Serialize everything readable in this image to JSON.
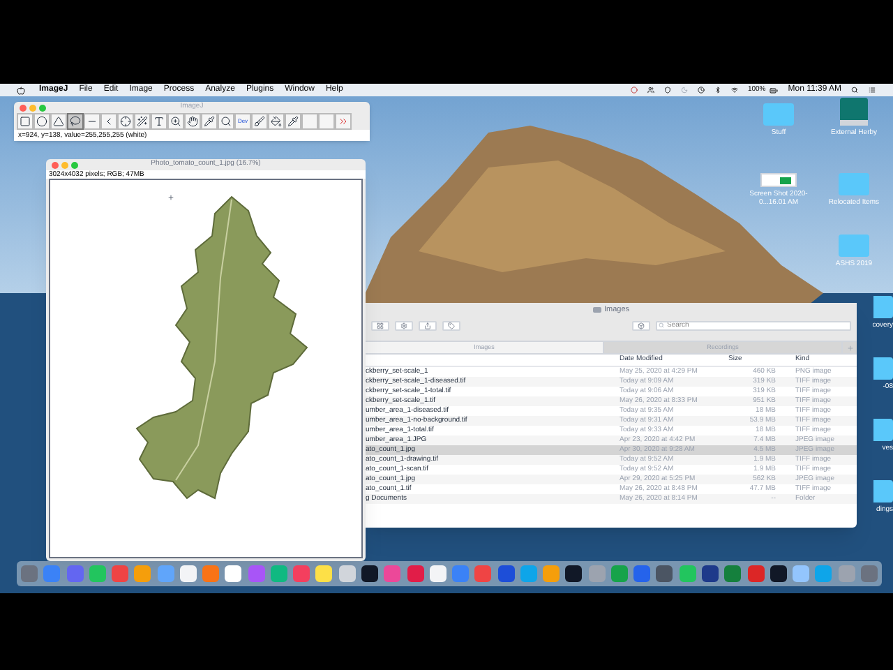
{
  "menu_bar": {
    "app": "ImageJ",
    "menus": [
      "File",
      "Edit",
      "Image",
      "Process",
      "Analyze",
      "Plugins",
      "Window",
      "Help"
    ],
    "battery": "100%",
    "clock": "Mon 11:39 AM"
  },
  "imagej_toolbar": {
    "title": "ImageJ",
    "tools": [
      {
        "kind": "rectangle",
        "selected": false
      },
      {
        "kind": "oval",
        "selected": false
      },
      {
        "kind": "polygon",
        "selected": false
      },
      {
        "kind": "freehand",
        "selected": true
      },
      {
        "kind": "line",
        "selected": false
      },
      {
        "kind": "angle",
        "selected": false
      },
      {
        "kind": "point",
        "selected": false
      },
      {
        "kind": "wand",
        "selected": false
      },
      {
        "kind": "text",
        "selected": false
      },
      {
        "kind": "zoom",
        "selected": false
      },
      {
        "kind": "hand",
        "selected": false
      },
      {
        "kind": "dropper",
        "selected": false
      },
      {
        "kind": "magnifier",
        "selected": false
      },
      {
        "kind": "dev",
        "label": "Dev",
        "selected": false
      },
      {
        "kind": "brush",
        "selected": false
      },
      {
        "kind": "flood",
        "selected": false
      },
      {
        "kind": "picker",
        "selected": false
      },
      {
        "kind": "blank",
        "selected": false
      },
      {
        "kind": "blank",
        "selected": false
      },
      {
        "kind": "more",
        "selected": false
      }
    ],
    "status": "x=924, y=138, value=255,255,255 (white)"
  },
  "image_window": {
    "title": "Photo_tomato_count_1.jpg (16.7%)",
    "info": "3024x4032 pixels; RGB; 47MB"
  },
  "finder": {
    "title": "Images",
    "search_placeholder": "Search",
    "tabs": [
      {
        "label": "Images",
        "selected": true
      },
      {
        "label": "Recordings",
        "selected": false
      }
    ],
    "columns": [
      "Date Modified",
      "Size",
      "Kind"
    ],
    "rows": [
      {
        "name": "ckberry_set-scale_1",
        "date": "May 25, 2020 at 4:29 PM",
        "size": "460 KB",
        "kind": "PNG image",
        "selected": false
      },
      {
        "name": "ckberry_set-scale_1-diseased.tif",
        "date": "Today at 9:09 AM",
        "size": "319 KB",
        "kind": "TIFF image",
        "selected": false
      },
      {
        "name": "ckberry_set-scale_1-total.tif",
        "date": "Today at 9:06 AM",
        "size": "319 KB",
        "kind": "TIFF image",
        "selected": false
      },
      {
        "name": "ckberry_set-scale_1.tif",
        "date": "May 26, 2020 at 8:33 PM",
        "size": "951 KB",
        "kind": "TIFF image",
        "selected": false
      },
      {
        "name": "umber_area_1-diseased.tif",
        "date": "Today at 9:35 AM",
        "size": "18 MB",
        "kind": "TIFF image",
        "selected": false
      },
      {
        "name": "umber_area_1-no-background.tif",
        "date": "Today at 9:31 AM",
        "size": "53.9 MB",
        "kind": "TIFF image",
        "selected": false
      },
      {
        "name": "umber_area_1-total.tif",
        "date": "Today at 9:33 AM",
        "size": "18 MB",
        "kind": "TIFF image",
        "selected": false
      },
      {
        "name": "umber_area_1.JPG",
        "date": "Apr 23, 2020 at 4:42 PM",
        "size": "7.4 MB",
        "kind": "JPEG image",
        "selected": false
      },
      {
        "name": "ato_count_1.jpg",
        "date": "Apr 30, 2020 at 9:28 AM",
        "size": "4.5 MB",
        "kind": "JPEG image",
        "selected": true
      },
      {
        "name": "ato_count_1-drawing.tif",
        "date": "Today at 9:52 AM",
        "size": "1.9 MB",
        "kind": "TIFF image",
        "selected": false
      },
      {
        "name": "ato_count_1-scan.tif",
        "date": "Today at 9:52 AM",
        "size": "1.9 MB",
        "kind": "TIFF image",
        "selected": false
      },
      {
        "name": "ato_count_1.jpg",
        "date": "Apr 29, 2020 at 5:25 PM",
        "size": "562 KB",
        "kind": "JPEG image",
        "selected": false
      },
      {
        "name": "ato_count_1.tif",
        "date": "May 26, 2020 at 8:48 PM",
        "size": "47.7 MB",
        "kind": "TIFF image",
        "selected": false
      },
      {
        "name": "g Documents",
        "date": "May 26, 2020 at 8:14 PM",
        "size": "--",
        "kind": "Folder",
        "selected": false
      }
    ]
  },
  "desktop_icons": [
    {
      "label": "Stuff",
      "kind": "folder"
    },
    {
      "label": "External Herby",
      "kind": "drive"
    },
    {
      "label": "Screen Shot 2020-0...16.01 AM",
      "kind": "screenshot"
    },
    {
      "label": "Relocated Items",
      "kind": "folder"
    },
    {
      "label": "ASHS 2019",
      "kind": "folder"
    },
    {
      "label": "covery",
      "kind": "folder"
    },
    {
      "label": "-08",
      "kind": "folder"
    },
    {
      "label": "ves",
      "kind": "folder"
    },
    {
      "label": "dings",
      "kind": "folder"
    }
  ]
}
